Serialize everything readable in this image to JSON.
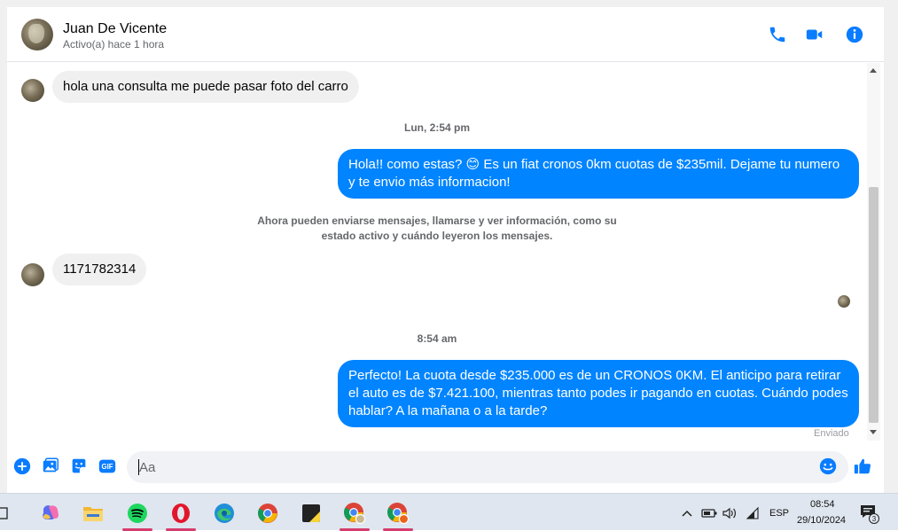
{
  "header": {
    "name": "Juan De Vicente",
    "status": "Activo(a) hace 1 hora",
    "icons": [
      "phone-icon",
      "video-icon",
      "info-icon"
    ]
  },
  "messages": {
    "incoming_1": "hola una consulta me puede pasar foto del carro",
    "timestamp_1": "Lun, 2:54 pm",
    "outgoing_1": "Hola!! como estas? 😊 Es un fiat cronos 0km cuotas de $235mil. Dejame tu numero y te envio más informacion!",
    "system_notice": "Ahora pueden enviarse mensajes, llamarse y ver información, como su estado activo y cuándo leyeron los mensajes.",
    "incoming_2": "1171782314",
    "timestamp_2": "8:54 am",
    "outgoing_2": "Perfecto! La cuota desde $235.000 es de un CRONOS 0KM. El anticipo para retirar el auto es de $7.421.100, mientras tanto podes ir pagando en cuotas. Cuándo podes hablar? A la mañana o a la tarde?",
    "delivery_status": "Enviado"
  },
  "composer": {
    "placeholder": "Aa",
    "buttons": [
      "add-icon",
      "image-icon",
      "sticker-icon",
      "gif-icon",
      "emoji-icon",
      "like-icon"
    ],
    "gif_label": "GIF"
  },
  "taskbar": {
    "apps": [
      "task-view",
      "copilot",
      "file-explorer",
      "spotify",
      "opera",
      "edge",
      "chrome",
      "sticky-notes",
      "chrome-profile",
      "chrome-profile-2"
    ],
    "language": "ESP",
    "time": "08:54",
    "date": "29/10/2024",
    "notification_count": "3"
  },
  "colors": {
    "accent": "#0084ff",
    "icon_blue": "#0a7cff",
    "bubble_in": "#f0f0f0",
    "text_secondary": "#65676b"
  }
}
